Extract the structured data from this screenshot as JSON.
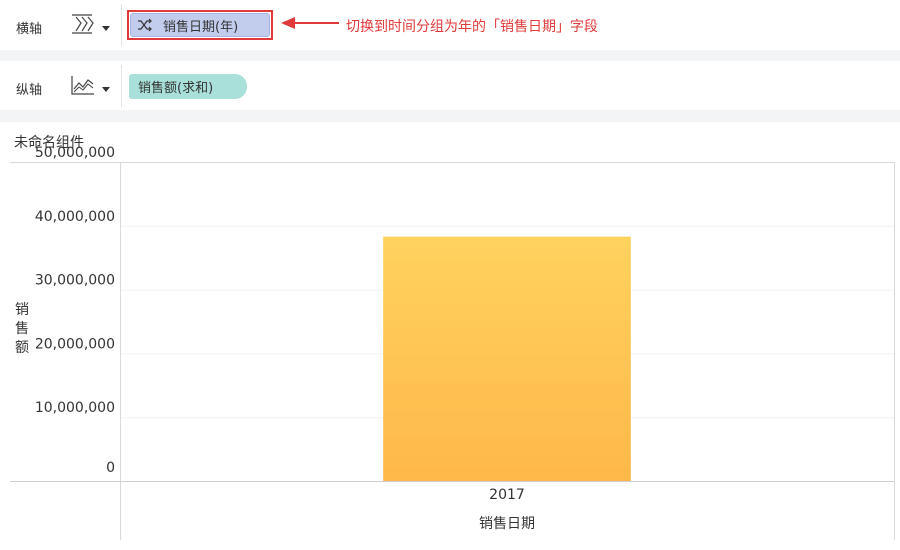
{
  "x_axis_row": {
    "label": "横轴",
    "field_pill": "销售日期(年)",
    "icon": "shuffle-icon",
    "type_icon": "dimension-axis-icon"
  },
  "y_axis_row": {
    "label": "纵轴",
    "field_pill": "销售额(求和)",
    "type_icon": "line-chart-icon"
  },
  "annotation": {
    "text": "切换到时间分组为年的「销售日期」字段",
    "color": "#e03a3a"
  },
  "widget": {
    "title": "未命名组件"
  },
  "chart_data": {
    "type": "bar",
    "categories": [
      "2017"
    ],
    "values": [
      38300000
    ],
    "xlabel": "销售日期",
    "ylabel": "销售额",
    "ylim": [
      0,
      50000000
    ],
    "yticks": [
      "0",
      "10,000,000",
      "20,000,000",
      "30,000,000",
      "40,000,000",
      "50,000,000"
    ],
    "bar_color_top": "#ffd25e",
    "bar_color_bottom": "#ffb84a",
    "grid": true,
    "legend": "none"
  }
}
